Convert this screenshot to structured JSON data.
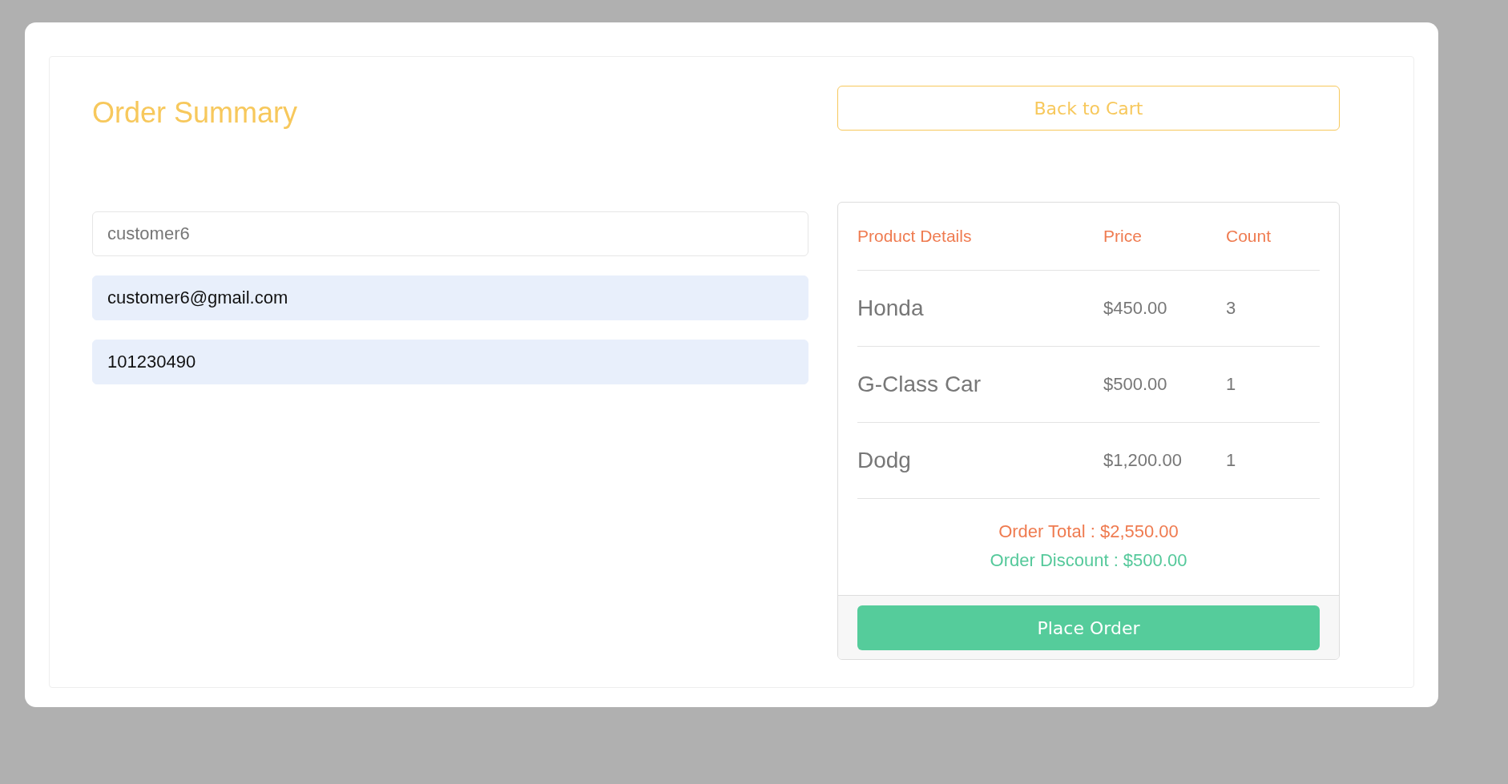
{
  "title": "Order Summary",
  "back_button": "Back to Cart",
  "fields": [
    {
      "placeholder": "customer6",
      "autofilled": false
    },
    {
      "value": "customer6@gmail.com",
      "autofilled": true
    },
    {
      "value": "101230490",
      "autofilled": true
    }
  ],
  "table": {
    "columns": [
      "Product Details",
      "Price",
      "Count"
    ],
    "rows": [
      {
        "product": "Honda",
        "price": "$450.00",
        "count": "3"
      },
      {
        "product": "G-Class Car",
        "price": "$500.00",
        "count": "1"
      },
      {
        "product": "Dodg",
        "price": "$1,200.00",
        "count": "1"
      }
    ]
  },
  "order_total": "Order Total : $2,550.00",
  "order_discount": "Order Discount : $500.00",
  "place_order_button": "Place Order"
}
